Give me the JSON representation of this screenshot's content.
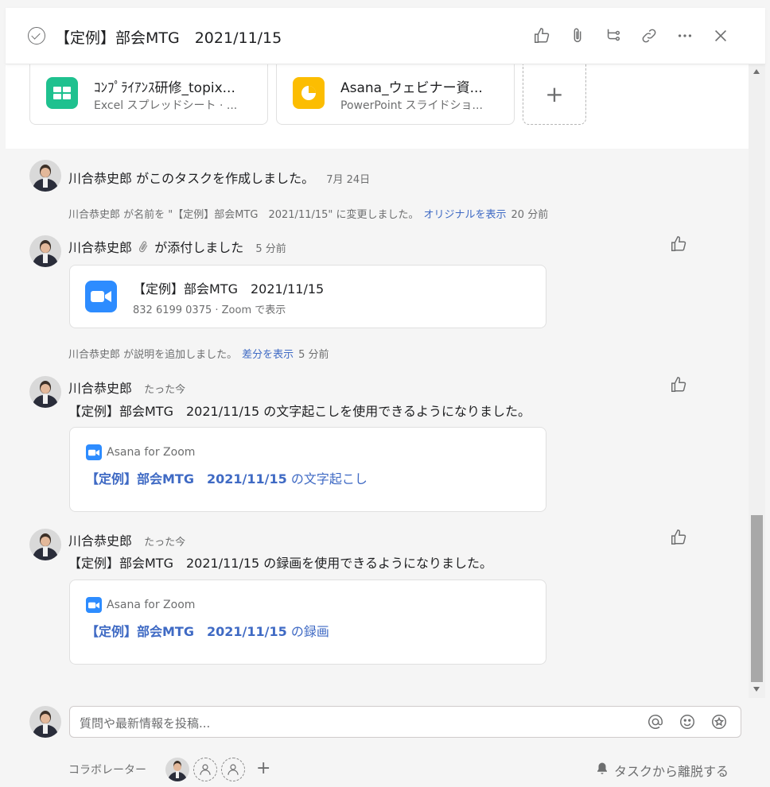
{
  "header": {
    "title": "【定例】部会MTG　2021/11/15",
    "icons": [
      "like-icon",
      "attach-icon",
      "subtask-icon",
      "link-icon",
      "more-icon",
      "close-icon"
    ]
  },
  "attachments": [
    {
      "name": "ｺﾝﾌﾟﾗｲｱﾝｽ研修_topix...",
      "sub": "Excel スプレッドシート · ...",
      "icon": "sheet-icon",
      "color": "#1fc18f"
    },
    {
      "name": "Asana_ウェビナー資...",
      "sub": "PowerPoint スライドショ...",
      "icon": "slides-icon",
      "color": "#fcbd01"
    }
  ],
  "feed": {
    "created": {
      "actor": "川合恭史郎",
      "text": "がこのタスクを作成しました。",
      "ts": "7月 24日"
    },
    "renamed": {
      "text": "川合恭史郎 が名前を \"【定例】部会MTG　2021/11/15\" に変更しました。",
      "link": "オリジナルを表示",
      "ts": "20 分前"
    },
    "attached": {
      "actor": "川合恭史郎",
      "text": "が添付しました",
      "ts": "5 分前",
      "card_title": "【定例】部会MTG　2021/11/15",
      "card_sub": "832 6199 0375 · Zoom で表示"
    },
    "desc": {
      "text": "川合恭史郎 が説明を追加しました。",
      "link": "差分を表示",
      "ts": "5 分前"
    },
    "transcript": {
      "actor": "川合恭史郎",
      "ts": "たった今",
      "body": "【定例】部会MTG　2021/11/15 の文字起こしを使用できるようになりました。",
      "app": "Asana for Zoom",
      "link_bold": "【定例】部会MTG　2021/11/15",
      "link_rest": " の文字起こし"
    },
    "recording": {
      "actor": "川合恭史郎",
      "ts": "たった今",
      "body": "【定例】部会MTG　2021/11/15 の録画を使用できるようになりました。",
      "app": "Asana for Zoom",
      "link_bold": "【定例】部会MTG　2021/11/15",
      "link_rest": " の録画"
    }
  },
  "composer": {
    "placeholder": "質問や最新情報を投稿..."
  },
  "footer": {
    "collab_label": "コラボレーター",
    "leave_label": "タスクから離脱する"
  },
  "colors": {
    "link": "#3f6ac4",
    "zoom": "#2d8cff"
  }
}
